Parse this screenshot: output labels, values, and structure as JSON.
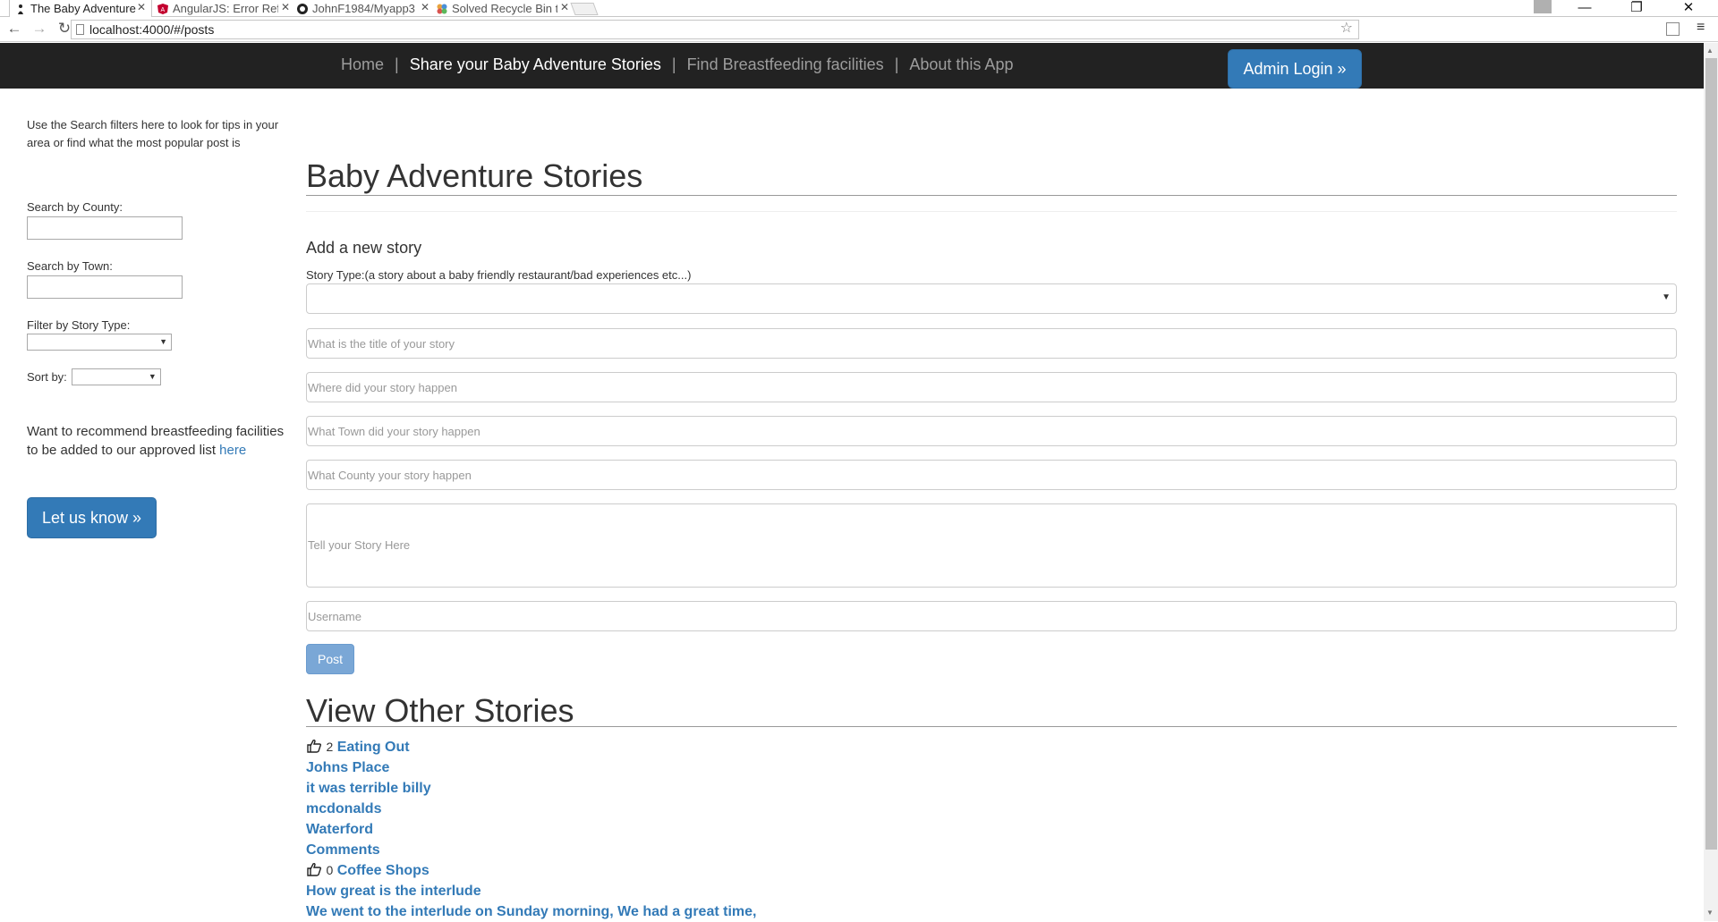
{
  "browser": {
    "tabs": [
      {
        "title": "The Baby Adventure",
        "active": true,
        "icon": "baby-icon"
      },
      {
        "title": "AngularJS: Error Refe",
        "active": false,
        "icon": "angular-icon"
      },
      {
        "title": "JohnF1984/Myapp3",
        "active": false,
        "icon": "github-icon"
      },
      {
        "title": "Solved Recycle Bin to",
        "active": false,
        "icon": "solved-icon"
      }
    ],
    "url": "localhost:4000/#/posts"
  },
  "navbar": {
    "links": [
      "Home",
      "Share your Baby Adventure Stories",
      "Find Breastfeeding facilities",
      "About this App"
    ],
    "separator": "|",
    "active_link": "Share your Baby Adventure Stories",
    "admin_button": "Admin Login »"
  },
  "sidebar": {
    "intro": "Use the Search filters here to look for tips in your area or find what the most popular post is",
    "county_label": "Search by County:",
    "town_label": "Search by Town:",
    "type_label": "Filter by Story Type:",
    "type_value": "",
    "sort_label": "Sort by:",
    "sort_value": "",
    "recommend_text": "Want to recommend breastfeeding facilities to be added to our approved list",
    "recommend_link": "here",
    "let_us_know_button": "Let us know »"
  },
  "main": {
    "title": "Baby Adventure Stories",
    "add_heading": "Add a new story",
    "story_type_label": "Story Type:(a story about a baby friendly restaurant/bad experiences etc...)",
    "story_type_value": "",
    "placeholders": {
      "title": "What is the title of your story",
      "where": "Where did your story happen",
      "town": "What Town did your story happen",
      "county": "What County your story happen",
      "story": "Tell your Story Here",
      "username": "Username"
    },
    "post_button": "Post",
    "view_heading": "View Other Stories"
  },
  "stories": [
    {
      "likes": "2",
      "type": "Eating Out",
      "place": "Johns Place",
      "title": "it was terrible billy",
      "location": "mcdonalds",
      "county": "Waterford",
      "comments": "Comments"
    },
    {
      "likes": "0",
      "type": "Coffee Shops",
      "place": "How great is the interlude",
      "title": "We went to the interlude on Sunday morning, We had a great time,"
    }
  ],
  "colors": {
    "navbar_bg": "#222222",
    "primary": "#337ab7",
    "post_button": "#7aa7d6"
  }
}
